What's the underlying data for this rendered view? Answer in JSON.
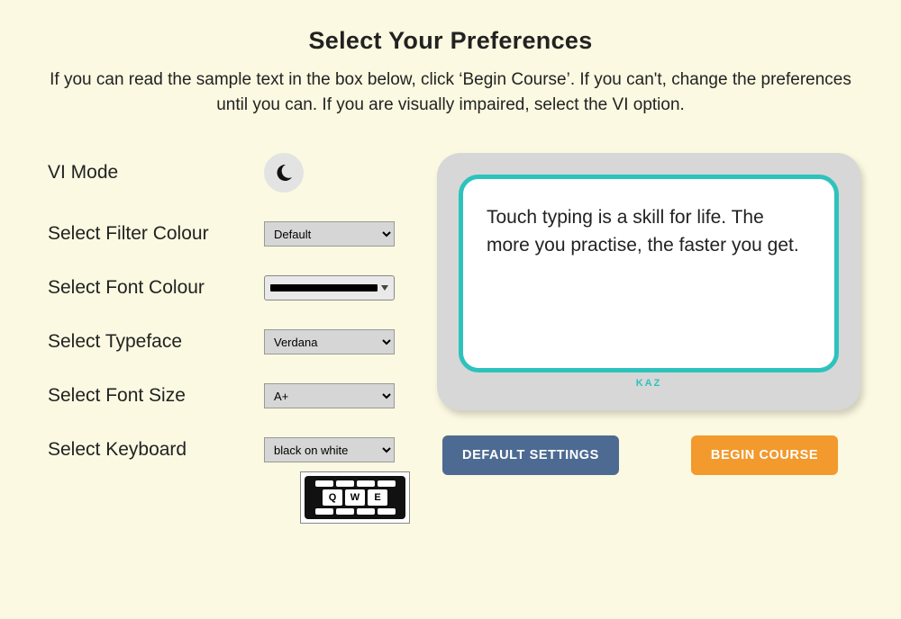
{
  "header": {
    "title": "Select Your Preferences",
    "subtitle": "If you can read the sample text in the box below, click ‘Begin Course’. If you can't, change the preferences until you can. If you are visually impaired, select the VI option."
  },
  "left": {
    "vi_mode_label": "VI Mode",
    "filter_colour_label": "Select Filter Colour",
    "filter_colour_value": "Default",
    "font_colour_label": "Select Font Colour",
    "font_colour_value": "#000000",
    "typeface_label": "Select Typeface",
    "typeface_value": "Verdana",
    "font_size_label": "Select Font Size",
    "font_size_value": "A+",
    "keyboard_label": "Select Keyboard",
    "keyboard_value": "black on white",
    "keyboard_keys": [
      "Q",
      "W",
      "E"
    ]
  },
  "preview": {
    "sample_text": "Touch typing is a skill for life. The more you practise, the faster you get.",
    "brand": "KAZ"
  },
  "buttons": {
    "default_settings": "DEFAULT SETTINGS",
    "begin_course": "BEGIN COURSE"
  }
}
